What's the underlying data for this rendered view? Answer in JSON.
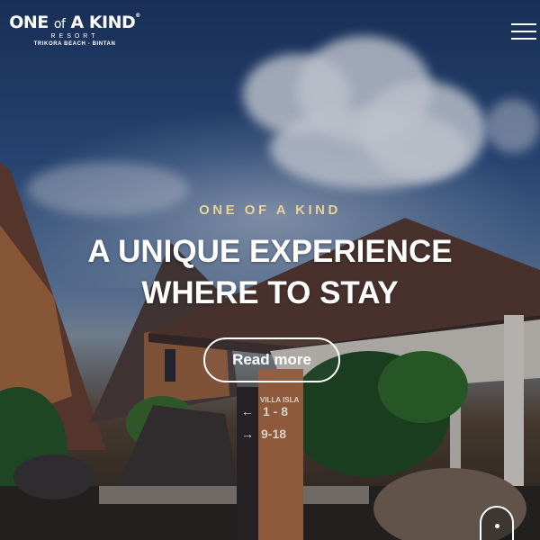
{
  "brand": {
    "name_one": "ONE",
    "name_of": "of",
    "name_kind": "A KIND",
    "registered": "®",
    "subtitle": "RESORT",
    "location": "TRIKORA BEACH - BINTAN"
  },
  "nav": {
    "menu_icon": "hamburger-menu-icon"
  },
  "hero": {
    "eyebrow": "ONE OF A KIND",
    "headline_line1": "A UNIQUE EXPERIENCE",
    "headline_line2": "WHERE TO STAY",
    "cta_label": "Read more"
  },
  "signpost": {
    "villa_label": "VILLA ISLA",
    "row1_arrow": "←",
    "row1_range": "1 - 8",
    "row2_arrow": "→",
    "row2_range": "9-18"
  },
  "scroll": {
    "icon": "scroll-down-mouse-icon"
  },
  "colors": {
    "eyebrow": "#e9d29a",
    "headline": "#ffffff",
    "sky_top": "#1d3763",
    "roof": "#5a3a2e"
  }
}
